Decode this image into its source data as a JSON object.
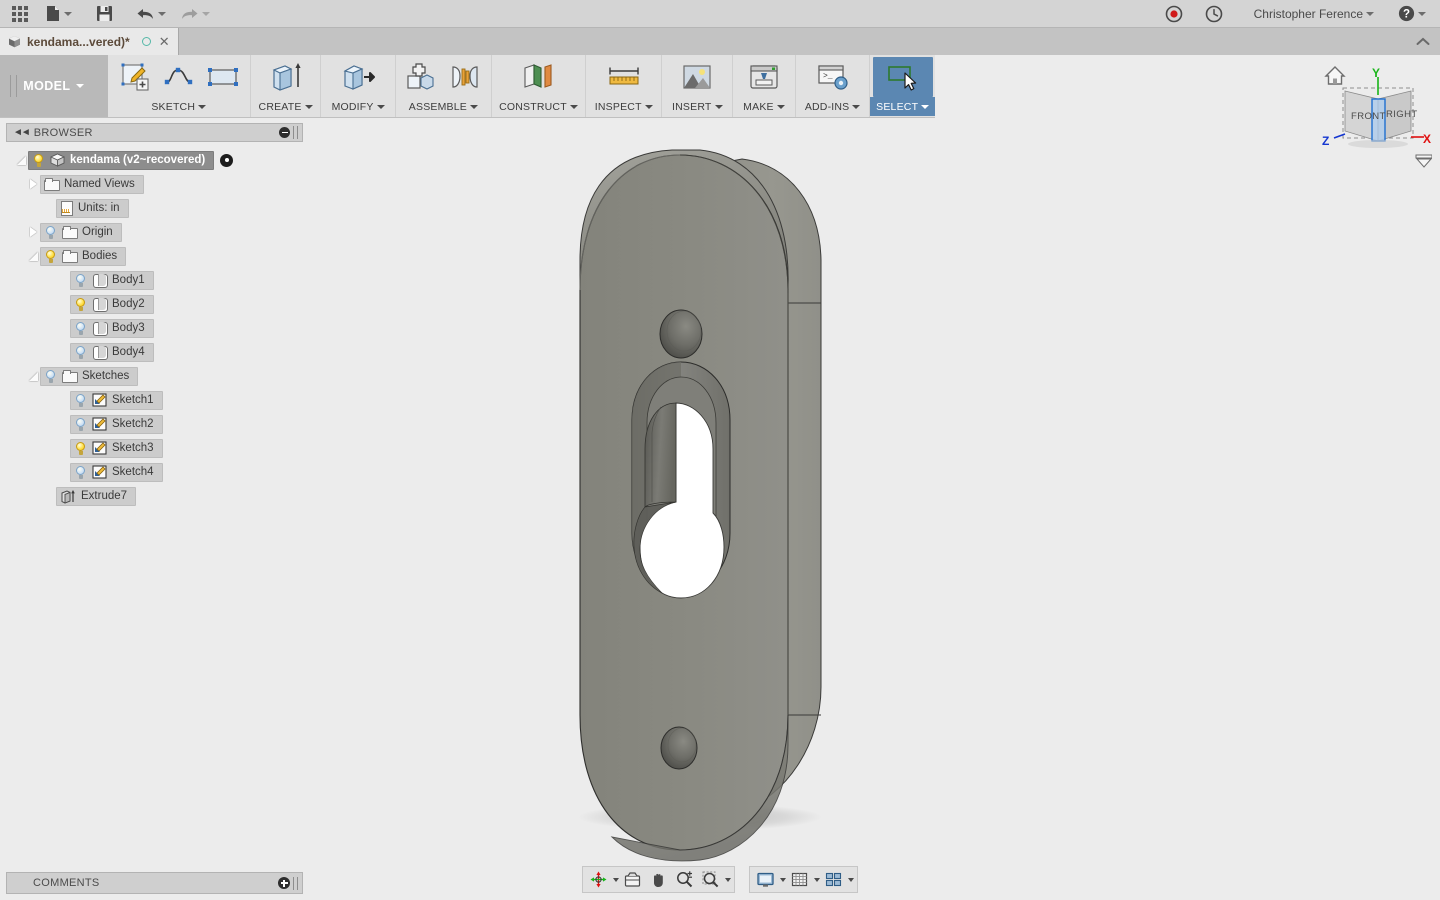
{
  "app": {
    "title_bar": {
      "apps_grid": "apps-grid-icon",
      "file": "file-icon",
      "save": "save-icon",
      "undo": "undo-icon",
      "redo": "redo-icon",
      "record": "record-icon",
      "history": "history-clock-icon",
      "user_name": "Christopher Ference",
      "help": "help-icon"
    },
    "tab": {
      "label": "kendama...vered)*",
      "cube_icon": "cube-icon",
      "sync_icon": "sync-circle-icon",
      "close_icon": "close-icon",
      "collapse_icon": "chevron-up-icon"
    }
  },
  "ribbon": {
    "workspace": "MODEL",
    "groups": [
      {
        "label": "SKETCH",
        "active": false,
        "items": [
          {
            "name": "create-sketch-icon"
          },
          {
            "name": "spline-icon"
          },
          {
            "name": "rectangle-icon"
          }
        ]
      },
      {
        "label": "CREATE",
        "active": false,
        "items": [
          {
            "name": "extrude-icon"
          }
        ]
      },
      {
        "label": "MODIFY",
        "active": false,
        "items": [
          {
            "name": "press-pull-icon"
          }
        ]
      },
      {
        "label": "ASSEMBLE",
        "active": false,
        "items": [
          {
            "name": "new-component-icon"
          },
          {
            "name": "joint-icon"
          }
        ]
      },
      {
        "label": "CONSTRUCT",
        "active": false,
        "items": [
          {
            "name": "offset-plane-icon"
          }
        ]
      },
      {
        "label": "INSPECT",
        "active": false,
        "items": [
          {
            "name": "measure-ruler-icon"
          }
        ]
      },
      {
        "label": "INSERT",
        "active": false,
        "items": [
          {
            "name": "insert-image-icon"
          }
        ]
      },
      {
        "label": "MAKE",
        "active": false,
        "items": [
          {
            "name": "3d-print-icon"
          }
        ]
      },
      {
        "label": "ADD-INS",
        "active": false,
        "items": [
          {
            "name": "scripts-addins-icon"
          }
        ]
      },
      {
        "label": "SELECT",
        "active": true,
        "items": [
          {
            "name": "select-cursor-icon"
          }
        ]
      }
    ]
  },
  "browser": {
    "header": "BROWSER",
    "collapse_icon": "collapse-left-icon",
    "minimize_icon": "minus-circle-icon",
    "tree": [
      {
        "label": "kendama (v2~recovered)",
        "indent": 0,
        "twist": "down",
        "bulb": "on",
        "icon": "cube-icon",
        "selected": true,
        "has_root_dot": true
      },
      {
        "label": "Named Views",
        "indent": 1,
        "twist": "right",
        "bulb": "none",
        "icon": "folder-icon"
      },
      {
        "label": "Units: in",
        "indent": 2,
        "twist": "none",
        "bulb": "none",
        "icon": "document-icon"
      },
      {
        "label": "Origin",
        "indent": 1,
        "twist": "right",
        "bulb": "off",
        "icon": "folder-icon"
      },
      {
        "label": "Bodies",
        "indent": 1,
        "twist": "down",
        "bulb": "on",
        "icon": "folder-icon"
      },
      {
        "label": "Body1",
        "indent": 3,
        "twist": "none",
        "bulb": "off",
        "icon": "body-icon"
      },
      {
        "label": "Body2",
        "indent": 3,
        "twist": "none",
        "bulb": "on",
        "icon": "body-icon"
      },
      {
        "label": "Body3",
        "indent": 3,
        "twist": "none",
        "bulb": "off",
        "icon": "body-icon"
      },
      {
        "label": "Body4",
        "indent": 3,
        "twist": "none",
        "bulb": "off",
        "icon": "body-icon"
      },
      {
        "label": "Sketches",
        "indent": 1,
        "twist": "down",
        "bulb": "off",
        "icon": "folder-icon"
      },
      {
        "label": "Sketch1",
        "indent": 3,
        "twist": "none",
        "bulb": "off",
        "icon": "sketch-icon"
      },
      {
        "label": "Sketch2",
        "indent": 3,
        "twist": "none",
        "bulb": "off",
        "icon": "sketch-icon"
      },
      {
        "label": "Sketch3",
        "indent": 3,
        "twist": "none",
        "bulb": "on",
        "icon": "sketch-icon"
      },
      {
        "label": "Sketch4",
        "indent": 3,
        "twist": "none",
        "bulb": "off",
        "icon": "sketch-icon"
      },
      {
        "label": "Extrude7",
        "indent": 2,
        "twist": "none",
        "bulb": "none",
        "icon": "extrude-feature-icon"
      }
    ]
  },
  "comments": {
    "label": "COMMENTS",
    "add_icon": "plus-circle-icon"
  },
  "viewcube": {
    "home_icon": "home-icon",
    "face_front": "FRONT",
    "face_right": "RIGHT",
    "axis_x": "X",
    "axis_y": "Y",
    "axis_z": "Z",
    "menu_icon": "viewcube-menu-icon"
  },
  "navbar": {
    "group1": [
      {
        "name": "orbit-icon",
        "caret": true
      },
      {
        "name": "fit-view-icon",
        "caret": false
      },
      {
        "name": "pan-hand-icon",
        "caret": false
      },
      {
        "name": "zoom-icon",
        "caret": false
      },
      {
        "name": "zoom-window-icon",
        "caret": true
      }
    ],
    "group2": [
      {
        "name": "display-settings-icon",
        "caret": true
      },
      {
        "name": "grid-snaps-icon",
        "caret": true
      },
      {
        "name": "viewports-icon",
        "caret": true
      }
    ]
  },
  "colors": {
    "accent_active": "#5b87b2",
    "model_face": "#88887f",
    "model_edge_face": "#91918a",
    "canvas_bg": "#ececec",
    "panel_bg": "#e1e1e1",
    "tab_text": "#5c4a3a",
    "axis_x": "#e01010",
    "axis_y": "#19b519",
    "axis_z": "#1436d0"
  }
}
